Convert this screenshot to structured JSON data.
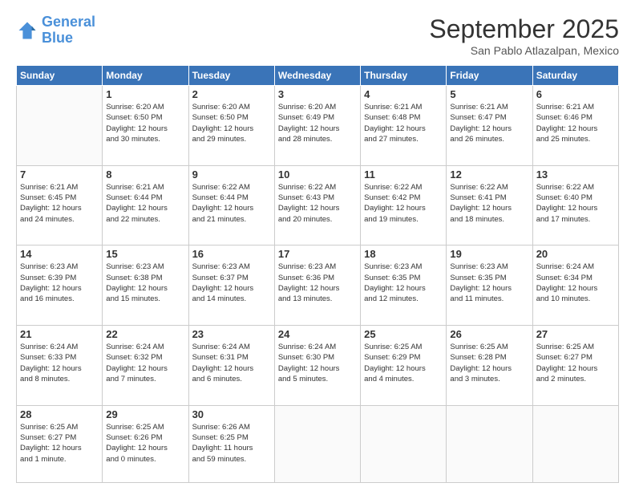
{
  "logo": {
    "line1": "General",
    "line2": "Blue"
  },
  "title": "September 2025",
  "subtitle": "San Pablo Atlazalpan, Mexico",
  "weekdays": [
    "Sunday",
    "Monday",
    "Tuesday",
    "Wednesday",
    "Thursday",
    "Friday",
    "Saturday"
  ],
  "weeks": [
    [
      {
        "day": "",
        "info": ""
      },
      {
        "day": "1",
        "info": "Sunrise: 6:20 AM\nSunset: 6:50 PM\nDaylight: 12 hours\nand 30 minutes."
      },
      {
        "day": "2",
        "info": "Sunrise: 6:20 AM\nSunset: 6:50 PM\nDaylight: 12 hours\nand 29 minutes."
      },
      {
        "day": "3",
        "info": "Sunrise: 6:20 AM\nSunset: 6:49 PM\nDaylight: 12 hours\nand 28 minutes."
      },
      {
        "day": "4",
        "info": "Sunrise: 6:21 AM\nSunset: 6:48 PM\nDaylight: 12 hours\nand 27 minutes."
      },
      {
        "day": "5",
        "info": "Sunrise: 6:21 AM\nSunset: 6:47 PM\nDaylight: 12 hours\nand 26 minutes."
      },
      {
        "day": "6",
        "info": "Sunrise: 6:21 AM\nSunset: 6:46 PM\nDaylight: 12 hours\nand 25 minutes."
      }
    ],
    [
      {
        "day": "7",
        "info": "Sunrise: 6:21 AM\nSunset: 6:45 PM\nDaylight: 12 hours\nand 24 minutes."
      },
      {
        "day": "8",
        "info": "Sunrise: 6:21 AM\nSunset: 6:44 PM\nDaylight: 12 hours\nand 22 minutes."
      },
      {
        "day": "9",
        "info": "Sunrise: 6:22 AM\nSunset: 6:44 PM\nDaylight: 12 hours\nand 21 minutes."
      },
      {
        "day": "10",
        "info": "Sunrise: 6:22 AM\nSunset: 6:43 PM\nDaylight: 12 hours\nand 20 minutes."
      },
      {
        "day": "11",
        "info": "Sunrise: 6:22 AM\nSunset: 6:42 PM\nDaylight: 12 hours\nand 19 minutes."
      },
      {
        "day": "12",
        "info": "Sunrise: 6:22 AM\nSunset: 6:41 PM\nDaylight: 12 hours\nand 18 minutes."
      },
      {
        "day": "13",
        "info": "Sunrise: 6:22 AM\nSunset: 6:40 PM\nDaylight: 12 hours\nand 17 minutes."
      }
    ],
    [
      {
        "day": "14",
        "info": "Sunrise: 6:23 AM\nSunset: 6:39 PM\nDaylight: 12 hours\nand 16 minutes."
      },
      {
        "day": "15",
        "info": "Sunrise: 6:23 AM\nSunset: 6:38 PM\nDaylight: 12 hours\nand 15 minutes."
      },
      {
        "day": "16",
        "info": "Sunrise: 6:23 AM\nSunset: 6:37 PM\nDaylight: 12 hours\nand 14 minutes."
      },
      {
        "day": "17",
        "info": "Sunrise: 6:23 AM\nSunset: 6:36 PM\nDaylight: 12 hours\nand 13 minutes."
      },
      {
        "day": "18",
        "info": "Sunrise: 6:23 AM\nSunset: 6:35 PM\nDaylight: 12 hours\nand 12 minutes."
      },
      {
        "day": "19",
        "info": "Sunrise: 6:23 AM\nSunset: 6:35 PM\nDaylight: 12 hours\nand 11 minutes."
      },
      {
        "day": "20",
        "info": "Sunrise: 6:24 AM\nSunset: 6:34 PM\nDaylight: 12 hours\nand 10 minutes."
      }
    ],
    [
      {
        "day": "21",
        "info": "Sunrise: 6:24 AM\nSunset: 6:33 PM\nDaylight: 12 hours\nand 8 minutes."
      },
      {
        "day": "22",
        "info": "Sunrise: 6:24 AM\nSunset: 6:32 PM\nDaylight: 12 hours\nand 7 minutes."
      },
      {
        "day": "23",
        "info": "Sunrise: 6:24 AM\nSunset: 6:31 PM\nDaylight: 12 hours\nand 6 minutes."
      },
      {
        "day": "24",
        "info": "Sunrise: 6:24 AM\nSunset: 6:30 PM\nDaylight: 12 hours\nand 5 minutes."
      },
      {
        "day": "25",
        "info": "Sunrise: 6:25 AM\nSunset: 6:29 PM\nDaylight: 12 hours\nand 4 minutes."
      },
      {
        "day": "26",
        "info": "Sunrise: 6:25 AM\nSunset: 6:28 PM\nDaylight: 12 hours\nand 3 minutes."
      },
      {
        "day": "27",
        "info": "Sunrise: 6:25 AM\nSunset: 6:27 PM\nDaylight: 12 hours\nand 2 minutes."
      }
    ],
    [
      {
        "day": "28",
        "info": "Sunrise: 6:25 AM\nSunset: 6:27 PM\nDaylight: 12 hours\nand 1 minute."
      },
      {
        "day": "29",
        "info": "Sunrise: 6:25 AM\nSunset: 6:26 PM\nDaylight: 12 hours\nand 0 minutes."
      },
      {
        "day": "30",
        "info": "Sunrise: 6:26 AM\nSunset: 6:25 PM\nDaylight: 11 hours\nand 59 minutes."
      },
      {
        "day": "",
        "info": ""
      },
      {
        "day": "",
        "info": ""
      },
      {
        "day": "",
        "info": ""
      },
      {
        "day": "",
        "info": ""
      }
    ]
  ]
}
